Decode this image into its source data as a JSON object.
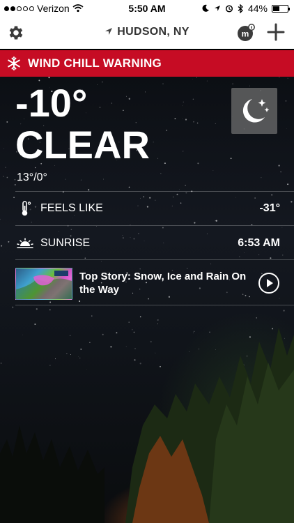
{
  "status_bar": {
    "carrier": "Verizon",
    "time": "5:50 AM",
    "battery": "44%",
    "battery_level": 0.44,
    "signal_bars_filled": 2,
    "signal_bars_total": 5
  },
  "nav": {
    "location": "HUDSON, NY",
    "icons": [
      "gear-icon",
      "location-arrow-icon",
      "mi-logo-icon",
      "plus-icon"
    ]
  },
  "warning": {
    "label": "WIND CHILL WARNING",
    "icon": "snowflake-icon",
    "color": "#c60c24"
  },
  "current": {
    "temperature": "-10°",
    "condition": "CLEAR",
    "hi_lo": "13°/0°",
    "condition_icon": "moon-stars-icon"
  },
  "details": [
    {
      "icon": "thermometer-icon",
      "label": "FEELS LIKE",
      "value": "-31°"
    },
    {
      "icon": "sunrise-icon",
      "label": "SUNRISE",
      "value": "6:53 AM"
    }
  ],
  "story": {
    "title": "Top Story: Snow, Ice and Rain On the Way",
    "icon": "play-icon"
  }
}
